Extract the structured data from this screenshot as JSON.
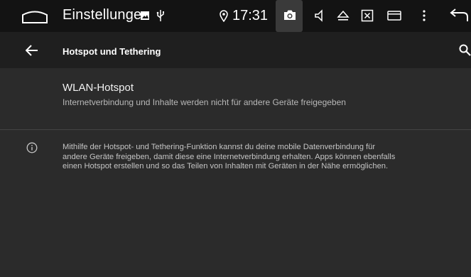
{
  "status_bar": {
    "app_title": "Einstellungen",
    "time": "17:31",
    "icons": [
      "home-icon",
      "image-icon",
      "usb-icon",
      "location-icon",
      "camera-icon",
      "volume-icon",
      "eject-icon",
      "close-box-icon",
      "window-icon",
      "more-vert-icon",
      "back-icon"
    ]
  },
  "app_bar": {
    "title": "Hotspot und Tethering",
    "icons": [
      "arrow-back-icon",
      "search-icon"
    ]
  },
  "hotspot_item": {
    "title": "WLAN-Hotspot",
    "subtitle": "Internetverbindung und Inhalte werden nicht für andere Geräte freigegeben"
  },
  "info": {
    "icon": "info-icon",
    "lines": [
      "Mithilfe der Hotspot- und Tethering-Funktion kannst du deine mobile Datenverbindung für",
      "andere Geräte freigeben, damit diese eine Internetverbindung erhalten. Apps können ebenfalls",
      "einen Hotspot erstellen und so das Teilen von Inhalten mit Geräten in der Nähe ermöglichen."
    ]
  },
  "colors": {
    "status_bar_bg": "#131313",
    "app_bar_bg": "#1f1f1f",
    "content_bg": "#2b2b2b",
    "camera_highlight": "#3a3a3a"
  }
}
